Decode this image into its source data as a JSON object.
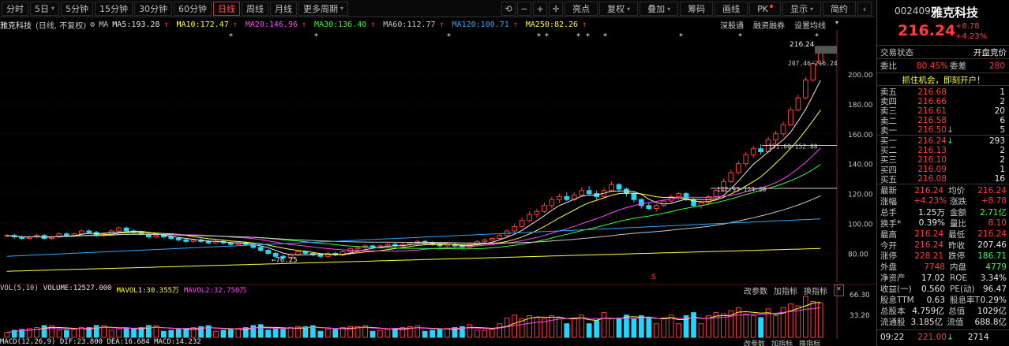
{
  "toolbar": {
    "left_buttons": [
      {
        "label": "分时",
        "active": false,
        "caret": false
      },
      {
        "label": "5日",
        "active": false,
        "caret": true
      },
      {
        "label": "5分钟",
        "active": false,
        "caret": false
      },
      {
        "label": "15分钟",
        "active": false,
        "caret": false
      },
      {
        "label": "30分钟",
        "active": false,
        "caret": false
      },
      {
        "label": "60分钟",
        "active": false,
        "caret": false
      },
      {
        "label": "日线",
        "active": true,
        "caret": false
      },
      {
        "label": "周线",
        "active": false,
        "caret": false
      },
      {
        "label": "月线",
        "active": false,
        "caret": false
      },
      {
        "label": "更多周期",
        "active": false,
        "caret": true
      }
    ],
    "right_buttons": [
      {
        "label": "亮点",
        "caret": false
      },
      {
        "label": "复权",
        "caret": true
      },
      {
        "label": "叠加",
        "caret": true
      },
      {
        "label": "筹码",
        "caret": false
      },
      {
        "label": "画线",
        "caret": false
      },
      {
        "label": "PK",
        "caret": false,
        "dot": true
      },
      {
        "label": "显示",
        "caret": true
      },
      {
        "label": "简约",
        "caret": false
      }
    ],
    "icons": [
      "refresh-icon",
      "zoom-out-icon",
      "zoom-in-icon",
      "crosshair-icon",
      "collapse-icon"
    ]
  },
  "infoline": {
    "stock_name": "雅克科技",
    "mode": "(日线, 不复权)",
    "ma_label": "MA",
    "items": [
      {
        "text": "MA5:193.28",
        "arrow": "↑",
        "color": "#e8e8e8"
      },
      {
        "text": "MA10:172.47",
        "arrow": "↑",
        "color": "#ffff33"
      },
      {
        "text": "MA20:146.96",
        "arrow": "↑",
        "color": "#ff44ff"
      },
      {
        "text": "MA30:136.40",
        "arrow": "↑",
        "color": "#33ff33"
      },
      {
        "text": "MA60:112.77",
        "arrow": "↑",
        "color": "#c8c8c8"
      },
      {
        "text": "MA120:100.71",
        "arrow": "↑",
        "color": "#2aa8ff"
      },
      {
        "text": "MA250:82.26",
        "arrow": "↑",
        "color": "#ffff33"
      }
    ],
    "links": [
      "深股通",
      "融资融券",
      "设置均线"
    ]
  },
  "main_axis": {
    "labels": [
      "200.00",
      "180.00",
      "160.00",
      "140.00",
      "120.00",
      "100.00",
      "80.00"
    ],
    "current": "216.24",
    "range_label": "207.46-216.24",
    "line1": "151.60-152.88",
    "line2": "122.93-124.00",
    "low_label": "←76.25",
    "marker": "S"
  },
  "volume": {
    "title": "VOL(5,10)",
    "volume": "VOLUME:12527.000",
    "mavol1": "MAVOL1:30.355万",
    "mavol2": "MAVOL2:32.750万",
    "tools": [
      "改参数",
      "加指标",
      "换指标"
    ],
    "axis": [
      "66.30",
      "33.20"
    ],
    "bottom_text": "MACD(12,26,9)  DIF:23.800  DEA:16.684  MACD:14.232",
    "bottom_tools": [
      "改参数",
      "加指标",
      "换指标"
    ]
  },
  "panel": {
    "code": "002409",
    "name": "雅克科技",
    "price": "216.24",
    "change": "+8.78",
    "change_pct": "+4.23%",
    "status_label": "交易状态",
    "status_value": "开盘竞价",
    "ratio_label": "委比",
    "ratio_value": "80.45%",
    "diff_label": "委差",
    "diff_value": "280",
    "banner": "抓住机会，即刻开户！",
    "sells": [
      {
        "label": "卖五",
        "price": "216.68",
        "qty": "1",
        "arrow": ""
      },
      {
        "label": "卖四",
        "price": "216.66",
        "qty": "2",
        "arrow": ""
      },
      {
        "label": "卖三",
        "price": "216.61",
        "qty": "20",
        "arrow": ""
      },
      {
        "label": "卖二",
        "price": "216.58",
        "qty": "6",
        "arrow": ""
      },
      {
        "label": "卖一",
        "price": "216.50",
        "qty": "5",
        "arrow": "↓"
      }
    ],
    "buys": [
      {
        "label": "买一",
        "price": "216.24",
        "qty": "293",
        "arrow": "↓"
      },
      {
        "label": "买二",
        "price": "216.13",
        "qty": "2",
        "arrow": ""
      },
      {
        "label": "买三",
        "price": "216.10",
        "qty": "2",
        "arrow": ""
      },
      {
        "label": "买四",
        "price": "216.09",
        "qty": "1",
        "arrow": ""
      },
      {
        "label": "买五",
        "price": "216.08",
        "qty": "16",
        "arrow": ""
      }
    ],
    "stats": [
      {
        "l1": "最新",
        "v1": "216.24",
        "c1": "red",
        "l2": "均价",
        "v2": "216.24",
        "c2": "red"
      },
      {
        "l1": "涨幅",
        "v1": "+4.23%",
        "c1": "red",
        "l2": "涨跌",
        "v2": "+8.78",
        "c2": "red"
      },
      {
        "l1": "总手",
        "v1": "1.25万",
        "c1": "white",
        "l2": "金额",
        "v2": "2.71亿",
        "c2": "green"
      },
      {
        "l1": "换手*",
        "v1": "0.39%",
        "c1": "white",
        "l2": "量比",
        "v2": "8.10",
        "c2": "red"
      },
      {
        "l1": "最高",
        "v1": "216.24",
        "c1": "red",
        "l2": "最低",
        "v2": "216.24",
        "c2": "red"
      },
      {
        "l1": "今开",
        "v1": "216.24",
        "c1": "red",
        "l2": "昨收",
        "v2": "207.46",
        "c2": "white"
      },
      {
        "l1": "涨停",
        "v1": "228.21",
        "c1": "red",
        "l2": "跌停",
        "v2": "186.71",
        "c2": "green"
      },
      {
        "l1": "外盘",
        "v1": "7748",
        "c1": "red",
        "l2": "内盘",
        "v2": "4779",
        "c2": "green"
      },
      {
        "l1": "净资产",
        "v1": "17.02",
        "c1": "white",
        "l2": "ROE",
        "v2": "3.34%",
        "c2": "white"
      },
      {
        "l1": "收益(一)",
        "v1": "0.560",
        "c1": "white",
        "l2": "PE(动)",
        "v2": "96.47",
        "c2": "white"
      },
      {
        "l1": "股息TTM",
        "v1": "0.63",
        "c1": "white",
        "l2": "股息率TTM",
        "v2": "0.29%",
        "c2": "white"
      },
      {
        "l1": "总股本",
        "v1": "4.759亿",
        "c1": "white",
        "l2": "总值",
        "v2": "1029亿",
        "c2": "white"
      },
      {
        "l1": "流通股",
        "v1": "3.185亿",
        "c1": "white",
        "l2": "流值",
        "v2": "688.8亿",
        "c2": "white"
      }
    ],
    "tick": {
      "time": "09:22",
      "price": "221.00",
      "arrow": "↓",
      "qty": "2714"
    }
  },
  "colors": {
    "up": "#ff3b3b",
    "down": "#22d6ff",
    "ma5": "#e8e8e8",
    "ma10": "#ffff33",
    "ma20": "#ff44ff",
    "ma30": "#33ff33",
    "ma60": "#c8c8c8",
    "ma120": "#2aa8ff",
    "ma250": "#ffff33"
  },
  "chart_data": {
    "type": "candlestick",
    "ylim": [
      66,
      220
    ],
    "candles": [
      [
        92,
        92,
        93,
        91
      ],
      [
        92,
        91,
        93,
        90
      ],
      [
        91,
        90,
        92,
        89
      ],
      [
        90,
        91,
        92,
        89
      ],
      [
        91,
        92,
        93,
        90
      ],
      [
        92,
        90,
        93,
        89
      ],
      [
        90,
        91,
        92,
        89
      ],
      [
        91,
        93,
        94,
        90
      ],
      [
        93,
        92,
        94,
        91
      ],
      [
        92,
        93,
        94,
        91
      ],
      [
        93,
        95,
        96,
        92
      ],
      [
        95,
        94,
        96,
        93
      ],
      [
        94,
        92,
        95,
        91
      ],
      [
        92,
        93,
        94,
        91
      ],
      [
        93,
        95,
        96,
        92
      ],
      [
        95,
        97,
        98,
        94
      ],
      [
        97,
        95,
        98,
        94
      ],
      [
        95,
        94,
        96,
        93
      ],
      [
        94,
        93,
        95,
        92
      ],
      [
        93,
        91,
        94,
        90
      ],
      [
        91,
        92,
        93,
        90
      ],
      [
        92,
        91,
        93,
        90
      ],
      [
        91,
        90,
        92,
        89
      ],
      [
        90,
        89,
        91,
        88
      ],
      [
        89,
        88,
        90,
        87
      ],
      [
        88,
        89,
        90,
        87
      ],
      [
        89,
        88,
        90,
        87
      ],
      [
        88,
        87,
        89,
        86
      ],
      [
        87,
        88,
        89,
        86
      ],
      [
        88,
        87,
        89,
        86
      ],
      [
        87,
        86,
        88,
        85
      ],
      [
        86,
        87,
        88,
        85
      ],
      [
        87,
        86,
        88,
        85
      ],
      [
        86,
        84,
        87,
        83
      ],
      [
        84,
        82,
        85,
        81
      ],
      [
        82,
        80,
        83,
        79
      ],
      [
        80,
        78,
        81,
        77
      ],
      [
        78,
        77,
        79,
        76
      ],
      [
        77,
        79,
        80,
        76
      ],
      [
        79,
        81,
        82,
        78
      ],
      [
        81,
        80,
        82,
        79
      ],
      [
        80,
        79,
        81,
        78
      ],
      [
        79,
        78,
        80,
        77
      ],
      [
        78,
        80,
        81,
        77
      ],
      [
        80,
        79,
        81,
        78
      ],
      [
        79,
        81,
        82,
        78
      ],
      [
        81,
        83,
        84,
        80
      ],
      [
        83,
        84,
        85,
        82
      ],
      [
        84,
        85,
        86,
        83
      ],
      [
        85,
        84,
        86,
        83
      ],
      [
        84,
        85,
        86,
        83
      ],
      [
        85,
        86,
        87,
        84
      ],
      [
        86,
        85,
        87,
        84
      ],
      [
        85,
        86,
        87,
        84
      ],
      [
        86,
        87,
        88,
        85
      ],
      [
        87,
        88,
        89,
        86
      ],
      [
        88,
        87,
        89,
        86
      ],
      [
        87,
        86,
        88,
        85
      ],
      [
        86,
        85,
        87,
        84
      ],
      [
        85,
        86,
        87,
        84
      ],
      [
        86,
        85,
        87,
        84
      ],
      [
        85,
        84,
        86,
        83
      ],
      [
        84,
        86,
        87,
        83
      ],
      [
        86,
        88,
        89,
        85
      ],
      [
        88,
        89,
        90,
        87
      ],
      [
        89,
        90,
        91,
        88
      ],
      [
        90,
        92,
        93,
        89
      ],
      [
        92,
        95,
        96,
        91
      ],
      [
        95,
        98,
        100,
        94
      ],
      [
        98,
        102,
        104,
        97
      ],
      [
        102,
        106,
        108,
        101
      ],
      [
        106,
        108,
        110,
        104
      ],
      [
        108,
        112,
        114,
        107
      ],
      [
        112,
        116,
        118,
        110
      ],
      [
        116,
        118,
        120,
        114
      ],
      [
        118,
        116,
        121,
        115
      ],
      [
        116,
        119,
        121,
        115
      ],
      [
        119,
        122,
        124,
        118
      ],
      [
        122,
        120,
        125,
        119
      ],
      [
        120,
        118,
        122,
        116
      ],
      [
        118,
        122,
        124,
        117
      ],
      [
        122,
        126,
        128,
        121
      ],
      [
        126,
        123,
        127,
        121
      ],
      [
        123,
        120,
        124,
        118
      ],
      [
        120,
        116,
        121,
        114
      ],
      [
        116,
        112,
        117,
        110
      ],
      [
        112,
        110,
        114,
        109
      ],
      [
        110,
        112,
        113,
        108
      ],
      [
        112,
        115,
        116,
        111
      ],
      [
        115,
        118,
        119,
        114
      ],
      [
        118,
        120,
        121,
        116
      ],
      [
        120,
        116,
        121,
        115
      ],
      [
        116,
        112,
        117,
        111
      ],
      [
        112,
        114,
        115,
        110
      ],
      [
        114,
        118,
        119,
        113
      ],
      [
        118,
        122,
        123,
        117
      ],
      [
        122,
        128,
        130,
        121
      ],
      [
        128,
        134,
        136,
        127
      ],
      [
        134,
        140,
        142,
        133
      ],
      [
        140,
        146,
        148,
        138
      ],
      [
        146,
        150,
        152,
        144
      ],
      [
        150,
        148,
        153,
        146
      ],
      [
        148,
        156,
        158,
        147
      ],
      [
        156,
        160,
        162,
        152
      ],
      [
        160,
        166,
        168,
        158
      ],
      [
        166,
        176,
        178,
        165
      ],
      [
        176,
        184,
        186,
        175
      ],
      [
        184,
        196,
        198,
        183
      ],
      [
        196,
        207,
        209,
        195
      ],
      [
        207,
        216,
        216,
        207
      ]
    ],
    "volume_max": 66.3
  }
}
